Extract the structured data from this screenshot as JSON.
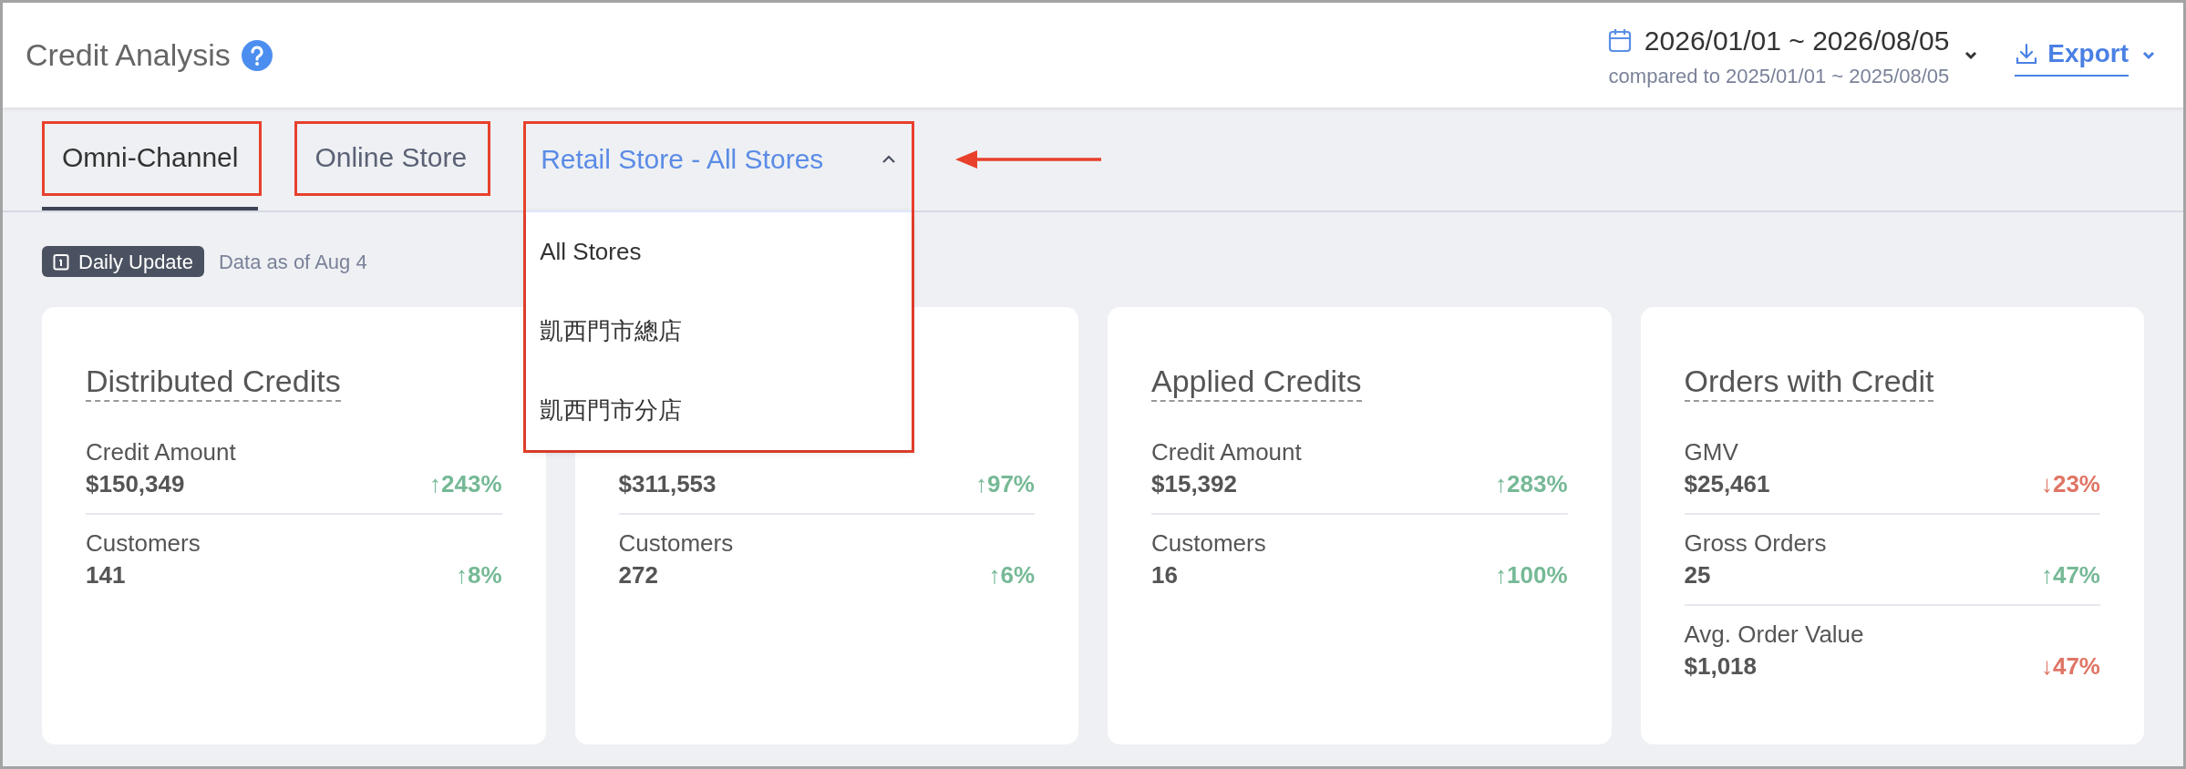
{
  "header": {
    "title": "Credit Analysis",
    "date_range": "2026/01/01 ~ 2026/08/05",
    "compared": "compared to 2025/01/01 ~ 2025/08/05",
    "export": "Export"
  },
  "tabs": [
    {
      "kind": "tab",
      "label": "Omni-Channel",
      "selected": true,
      "highlighted": true
    },
    {
      "kind": "tab",
      "label": "Online Store",
      "selected": false,
      "highlighted": true
    },
    {
      "kind": "dropdown",
      "label": "Retail Store - All Stores",
      "selected": false,
      "highlighted": true,
      "expanded": true,
      "options": [
        "All Stores",
        "凱西門市總店",
        "凱西門市分店"
      ]
    }
  ],
  "update": {
    "badge": "Daily Update",
    "note": "Data as of Aug 4"
  },
  "cards": [
    {
      "title": "Distributed Credits",
      "metrics": [
        {
          "label": "Credit Amount",
          "value": "$150,349",
          "change": "↑243%",
          "color": "#76b996"
        },
        {
          "label": "Customers",
          "value": "141",
          "change": "↑8%",
          "color": "#76b996"
        }
      ]
    },
    {
      "metrics": [
        {
          "value": "$311,553",
          "change": "↑97%",
          "color": "#76b996"
        },
        {
          "label": "Customers",
          "value": "272",
          "change": "↑6%",
          "color": "#76b996"
        }
      ]
    },
    {
      "title": "Applied Credits",
      "metrics": [
        {
          "label": "Credit Amount",
          "value": "$15,392",
          "change": "↑283%",
          "color": "#76b996"
        },
        {
          "label": "Customers",
          "value": "16",
          "change": "↑100%",
          "color": "#76b996"
        }
      ]
    },
    {
      "title": "Orders with Credit",
      "metrics": [
        {
          "label": "GMV",
          "value": "$25,461",
          "change": "↓23%",
          "color": "#e07565"
        },
        {
          "label": "Gross Orders",
          "value": "25",
          "change": "↑47%",
          "color": "#76b996"
        },
        {
          "label": "Avg. Order Value",
          "value": "$1,018",
          "change": "↓47%",
          "color": "#e07565"
        }
      ]
    }
  ]
}
